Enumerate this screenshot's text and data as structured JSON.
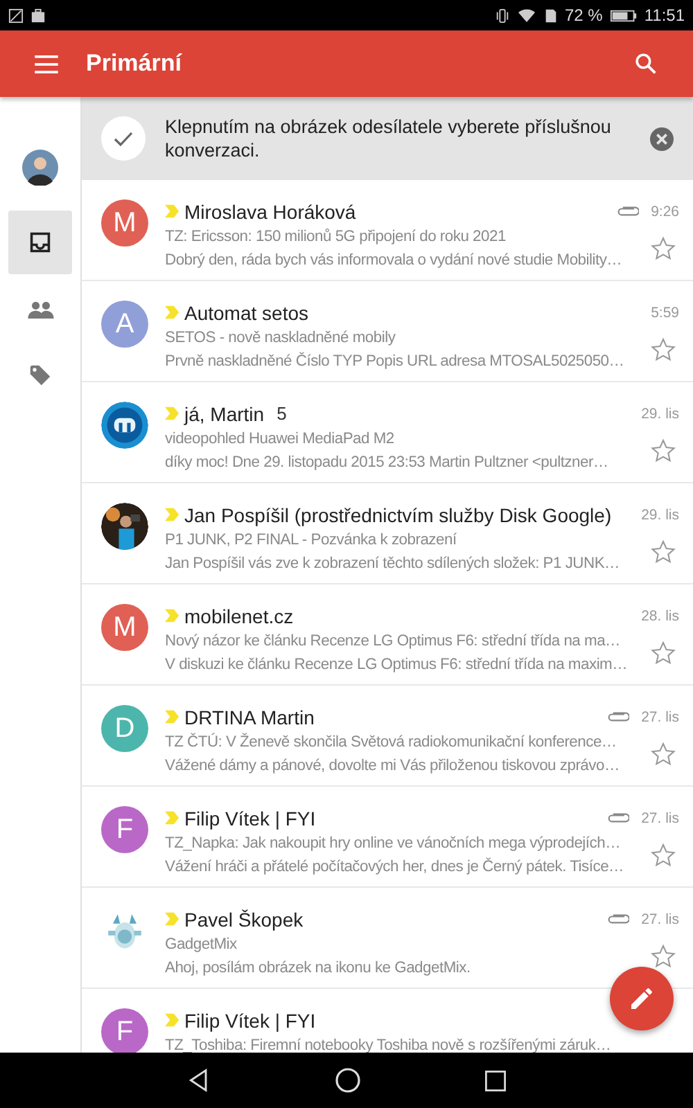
{
  "status_bar": {
    "battery": "72 %",
    "time": "11:51"
  },
  "app_bar": {
    "title": "Primární"
  },
  "rail": {
    "items": [
      {
        "kind": "account",
        "selected": false
      },
      {
        "kind": "inbox",
        "selected": true
      },
      {
        "kind": "people",
        "selected": false
      },
      {
        "kind": "label",
        "selected": false
      }
    ]
  },
  "banner": {
    "text": "Klepnutím na obrázek odesílatele vyberete příslušnou konverzaci."
  },
  "emails": [
    {
      "avatar": {
        "kind": "letter",
        "letter": "M",
        "color": "#e06055"
      },
      "important": true,
      "sender": "Miroslava Horáková",
      "subject": "TZ: Ericsson: 150 milionů 5G připojení do roku 2021",
      "snippet": "Dobrý den, ráda bych vás informovala o vydání nové studie Mobility…",
      "time": "9:26",
      "attachment": true,
      "starred": false
    },
    {
      "avatar": {
        "kind": "letter",
        "letter": "A",
        "color": "#919fd8"
      },
      "important": true,
      "sender": "Automat setos",
      "subject": "SETOS - nově naskladněné mobily",
      "snippet": "Prvně naskladněné Číslo TYP Popis URL adresa MTOSAL5025050…",
      "time": "5:59",
      "attachment": false,
      "starred": false
    },
    {
      "important": true,
      "sender": "já, Martin",
      "count": "5",
      "subject": "videopohled Huawei MediaPad M2",
      "snippet": "díky moc! Dne 29. listopadu 2015 23:53 Martin Pultzner <pultzner…",
      "time": "29. lis",
      "attachment": false,
      "starred": false
    },
    {
      "important": true,
      "sender": "Jan Pospíšil (prostřednictvím služby Disk Google)",
      "subject": "P1 JUNK, P2 FINAL - Pozvánka k zobrazení",
      "snippet": "Jan Pospíšil vás zve k zobrazení těchto sdílených složek: P1 JUNK…",
      "time": "29. lis",
      "attachment": false,
      "starred": false
    },
    {
      "avatar": {
        "kind": "letter",
        "letter": "M",
        "color": "#e06055"
      },
      "important": true,
      "sender": "mobilenet.cz",
      "subject": "Nový názor ke článku Recenze LG Optimus F6: střední třída na ma…",
      "snippet": "V diskuzi ke článku Recenze LG Optimus F6: střední třída na maxim…",
      "time": "28. lis",
      "attachment": false,
      "starred": false
    },
    {
      "avatar": {
        "kind": "letter",
        "letter": "D",
        "color": "#4db6ac"
      },
      "important": true,
      "sender": "DRTINA Martin",
      "subject": "TZ ČTÚ: V Ženevě skončila Světová radiokomunikační konference…",
      "snippet": "Vážené dámy a pánové, dovolte mi Vás přiloženou tiskovou zprávo…",
      "time": "27. lis",
      "attachment": true,
      "starred": false
    },
    {
      "avatar": {
        "kind": "letter",
        "letter": "F",
        "color": "#ba68c8"
      },
      "important": true,
      "sender": "Filip Vítek | FYI",
      "subject": "TZ_Napka: Jak nakoupit hry online ve vánočních mega výprodejích…",
      "snippet": "Vážení hráči a přátelé počítačových her, dnes je Černý pátek. Tisíce…",
      "time": "27. lis",
      "attachment": true,
      "starred": false
    },
    {
      "important": true,
      "sender": "Pavel Škopek",
      "subject": "GadgetMix",
      "snippet": "Ahoj, posílám obrázek na ikonu ke GadgetMix.",
      "time": "27. lis",
      "attachment": true,
      "starred": false
    },
    {
      "avatar": {
        "kind": "letter",
        "letter": "F",
        "color": "#ba68c8"
      },
      "important": true,
      "sender": "Filip Vítek | FYI",
      "subject": "TZ_Toshiba: Firemní notebooky Toshiba nově s rozšířenými záruk…"
    }
  ]
}
